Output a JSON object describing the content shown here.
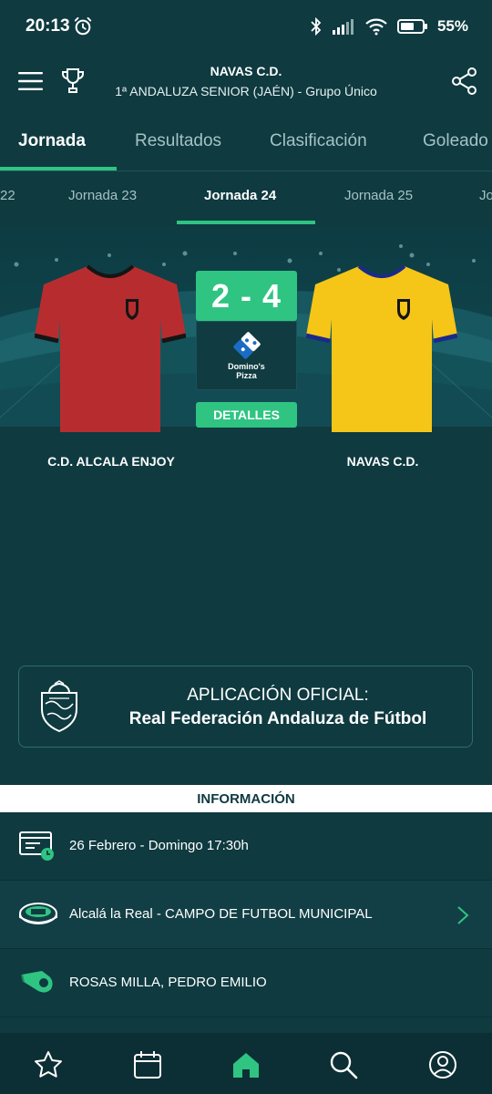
{
  "status": {
    "time": "20:13",
    "battery": "55%"
  },
  "header": {
    "title": "NAVAS C.D.",
    "subtitle": "1ª ANDALUZA SENIOR (JAÉN) - Grupo Único"
  },
  "tabs": [
    {
      "label": "Jornada",
      "active": true
    },
    {
      "label": "Resultados",
      "active": false
    },
    {
      "label": "Clasificación",
      "active": false
    },
    {
      "label": "Goleado",
      "active": false
    }
  ],
  "jornadas": [
    {
      "label": "22"
    },
    {
      "label": "Jornada 23"
    },
    {
      "label": "Jornada 24",
      "active": true
    },
    {
      "label": "Jornada 25"
    },
    {
      "label": "Jo"
    }
  ],
  "match": {
    "home": {
      "name": "C.D. ALCALA ENJOY",
      "color": "#b72d2f"
    },
    "away": {
      "name": "NAVAS C.D.",
      "color": "#f5c518"
    },
    "score": "2 - 4",
    "sponsor": "Domino's Pizza",
    "details_label": "DETALLES"
  },
  "federation": {
    "line1": "APLICACIÓN OFICIAL:",
    "line2": "Real Federación Andaluza de Fútbol"
  },
  "info": {
    "header": "INFORMACIÓN",
    "datetime": "26 Febrero - Domingo 17:30h",
    "venue": "Alcalá la Real - CAMPO DE FUTBOL MUNICIPAL",
    "referee": "ROSAS MILLA, PEDRO EMILIO"
  },
  "colors": {
    "accent": "#2fc482",
    "background": "#0e3a40"
  }
}
